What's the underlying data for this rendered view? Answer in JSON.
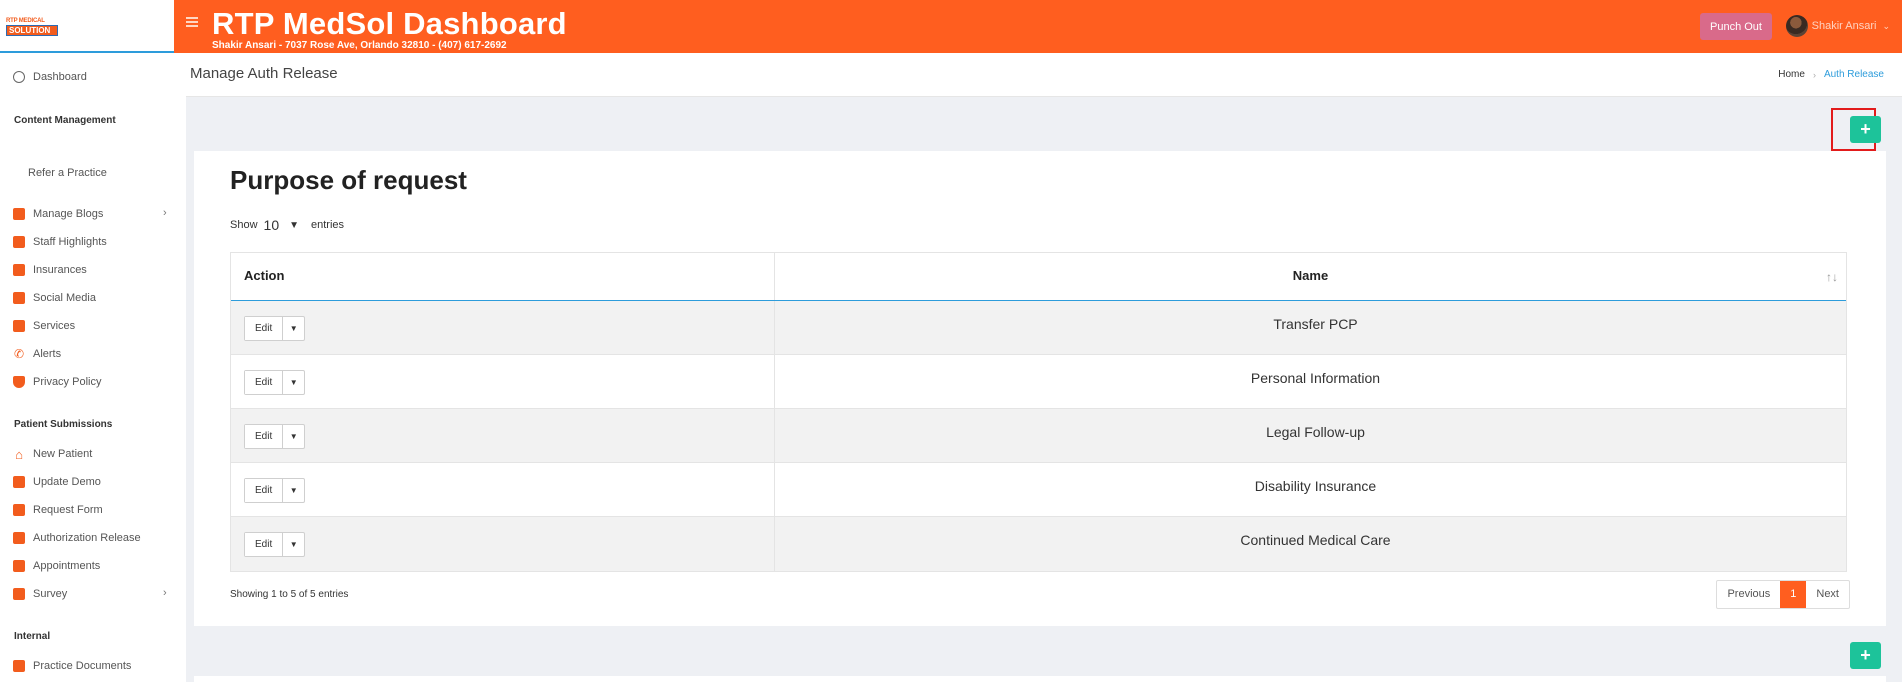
{
  "header": {
    "logo_line1": "RTP MEDICAL",
    "logo_line2": "SOLUTION",
    "title": "RTP MedSol Dashboard",
    "subtitle": "Shakir Ansari - 7037 Rose Ave, Orlando 32810 - (407) 617-2692",
    "punch_label": "Punch Out",
    "user_name": "Shakir Ansari",
    "accent_color": "#ff5e1f"
  },
  "sidebar": {
    "dashboard": "Dashboard",
    "content_heading": "Content Management",
    "refer": "Refer a Practice",
    "content_items": [
      {
        "label": "Manage Blogs",
        "icon": "blog-icon"
      },
      {
        "label": "Staff Highlights",
        "icon": "staff-icon"
      },
      {
        "label": "Insurances",
        "icon": "insurance-icon"
      },
      {
        "label": "Social Media",
        "icon": "social-icon"
      },
      {
        "label": "Services",
        "icon": "services-icon"
      },
      {
        "label": "Alerts",
        "icon": "phone-icon"
      },
      {
        "label": "Privacy Policy",
        "icon": "shield-icon"
      }
    ],
    "patient_heading": "Patient Submissions",
    "patient_items": [
      {
        "label": "New Patient",
        "icon": "home-icon"
      },
      {
        "label": "Update Demo",
        "icon": "card-icon"
      },
      {
        "label": "Request Form",
        "icon": "form-icon"
      },
      {
        "label": "Authorization Release",
        "icon": "check-doc-icon"
      },
      {
        "label": "Appointments",
        "icon": "calendar-icon"
      },
      {
        "label": "Survey",
        "icon": "chart-icon"
      }
    ],
    "internal_heading": "Internal",
    "internal_items": [
      {
        "label": "Practice Documents",
        "icon": "clipboard-icon"
      }
    ]
  },
  "page": {
    "title": "Manage Auth Release",
    "breadcrumb_home": "Home",
    "breadcrumb_current": "Auth Release"
  },
  "card": {
    "title": "Purpose of request",
    "show_label": "Show",
    "entries_count": "10",
    "entries_label": "entries",
    "columns": [
      "Action",
      "Name"
    ],
    "edit_label": "Edit",
    "rows": [
      {
        "name": "Transfer PCP"
      },
      {
        "name": "Personal Information"
      },
      {
        "name": "Legal Follow-up"
      },
      {
        "name": "Disability Insurance"
      },
      {
        "name": "Continued Medical Care"
      }
    ],
    "showing_text": "Showing 1 to 5 of 5 entries",
    "pager": {
      "previous": "Previous",
      "current": "1",
      "next": "Next"
    }
  },
  "add_label": "+"
}
